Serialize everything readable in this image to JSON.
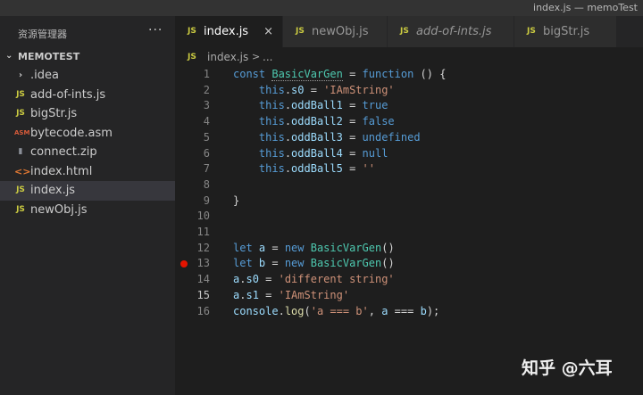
{
  "window": {
    "title": "index.js — memoTest"
  },
  "sidebar": {
    "title": "资源管理器",
    "more_label": "···",
    "folder": {
      "name": "MEMOTEST"
    },
    "items": [
      {
        "label": ".idea",
        "icon": "chevron-right-icon",
        "glyph": "›"
      },
      {
        "label": "add-of-ints.js",
        "icon": "js-file-icon",
        "glyph": "JS"
      },
      {
        "label": "bigStr.js",
        "icon": "js-file-icon",
        "glyph": "JS"
      },
      {
        "label": "bytecode.asm",
        "icon": "asm-file-icon",
        "glyph": "ASM"
      },
      {
        "label": "connect.zip",
        "icon": "zip-file-icon",
        "glyph": "▮"
      },
      {
        "label": "index.html",
        "icon": "html-file-icon",
        "glyph": "<>"
      },
      {
        "label": "index.js",
        "icon": "js-file-icon",
        "glyph": "JS",
        "active": true
      },
      {
        "label": "newObj.js",
        "icon": "js-file-icon",
        "glyph": "JS"
      }
    ]
  },
  "tabs": [
    {
      "label": "index.js",
      "icon_glyph": "JS",
      "active": true,
      "close": "×"
    },
    {
      "label": "newObj.js",
      "icon_glyph": "JS"
    },
    {
      "label": "add-of-ints.js",
      "icon_glyph": "JS",
      "italic": true
    },
    {
      "label": "bigStr.js",
      "icon_glyph": "JS"
    }
  ],
  "breadcrumb": {
    "icon_glyph": "JS",
    "file": "index.js",
    "separator": ">",
    "trail": "..."
  },
  "editor": {
    "current_line": 15,
    "breakpoint_line": 13,
    "lines": [
      {
        "n": "1",
        "tokens": [
          [
            "k",
            "const "
          ],
          [
            "c",
            "BasicVarGen"
          ],
          [
            "p",
            " = "
          ],
          [
            "k",
            "function"
          ],
          [
            "p",
            " () {"
          ]
        ]
      },
      {
        "n": "2",
        "tokens": [
          [
            "p",
            "    "
          ],
          [
            "k",
            "this"
          ],
          [
            "p",
            "."
          ],
          [
            "v",
            "s0"
          ],
          [
            "p",
            " = "
          ],
          [
            "s",
            "'IAmString'"
          ]
        ]
      },
      {
        "n": "3",
        "tokens": [
          [
            "p",
            "    "
          ],
          [
            "k",
            "this"
          ],
          [
            "p",
            "."
          ],
          [
            "v",
            "oddBall1"
          ],
          [
            "p",
            " = "
          ],
          [
            "k",
            "true"
          ]
        ]
      },
      {
        "n": "4",
        "tokens": [
          [
            "p",
            "    "
          ],
          [
            "k",
            "this"
          ],
          [
            "p",
            "."
          ],
          [
            "v",
            "oddBall2"
          ],
          [
            "p",
            " = "
          ],
          [
            "k",
            "false"
          ]
        ]
      },
      {
        "n": "5",
        "tokens": [
          [
            "p",
            "    "
          ],
          [
            "k",
            "this"
          ],
          [
            "p",
            "."
          ],
          [
            "v",
            "oddBall3"
          ],
          [
            "p",
            " = "
          ],
          [
            "k",
            "undefined"
          ]
        ]
      },
      {
        "n": "6",
        "tokens": [
          [
            "p",
            "    "
          ],
          [
            "k",
            "this"
          ],
          [
            "p",
            "."
          ],
          [
            "v",
            "oddBall4"
          ],
          [
            "p",
            " = "
          ],
          [
            "k",
            "null"
          ]
        ]
      },
      {
        "n": "7",
        "tokens": [
          [
            "p",
            "    "
          ],
          [
            "k",
            "this"
          ],
          [
            "p",
            "."
          ],
          [
            "v",
            "oddBall5"
          ],
          [
            "p",
            " = "
          ],
          [
            "s",
            "''"
          ]
        ]
      },
      {
        "n": "8",
        "tokens": []
      },
      {
        "n": "9",
        "tokens": [
          [
            "p",
            "}"
          ]
        ]
      },
      {
        "n": "10",
        "tokens": []
      },
      {
        "n": "11",
        "tokens": []
      },
      {
        "n": "12",
        "tokens": [
          [
            "k",
            "let "
          ],
          [
            "v",
            "a"
          ],
          [
            "p",
            " = "
          ],
          [
            "k",
            "new "
          ],
          [
            "c",
            "BasicVarGen"
          ],
          [
            "p",
            "()"
          ]
        ]
      },
      {
        "n": "13",
        "tokens": [
          [
            "k",
            "let "
          ],
          [
            "v",
            "b"
          ],
          [
            "p",
            " = "
          ],
          [
            "k",
            "new "
          ],
          [
            "c",
            "BasicVarGen"
          ],
          [
            "p",
            "()"
          ]
        ]
      },
      {
        "n": "14",
        "tokens": [
          [
            "v",
            "a"
          ],
          [
            "p",
            "."
          ],
          [
            "v",
            "s0"
          ],
          [
            "p",
            " = "
          ],
          [
            "s",
            "'different string'"
          ]
        ]
      },
      {
        "n": "15",
        "tokens": [
          [
            "v",
            "a"
          ],
          [
            "p",
            "."
          ],
          [
            "v",
            "s1"
          ],
          [
            "p",
            " = "
          ],
          [
            "s",
            "'IAmString'"
          ]
        ]
      },
      {
        "n": "16",
        "tokens": [
          [
            "v",
            "console"
          ],
          [
            "p",
            "."
          ],
          [
            "f",
            "log"
          ],
          [
            "p",
            "("
          ],
          [
            "s",
            "'a === b'"
          ],
          [
            "p",
            ", "
          ],
          [
            "v",
            "a"
          ],
          [
            "p",
            " === "
          ],
          [
            "v",
            "b"
          ],
          [
            "p",
            ");"
          ]
        ]
      }
    ]
  },
  "watermark": {
    "text": "知乎 @六耳"
  },
  "colors": {
    "keyword": "#569cd6",
    "variable": "#9cdcfe",
    "class": "#4ec9b0",
    "string": "#ce9178",
    "function": "#dcdcaa",
    "punct": "#d4d4d4",
    "js_icon": "#cbcb41",
    "breakpoint": "#e51400"
  }
}
